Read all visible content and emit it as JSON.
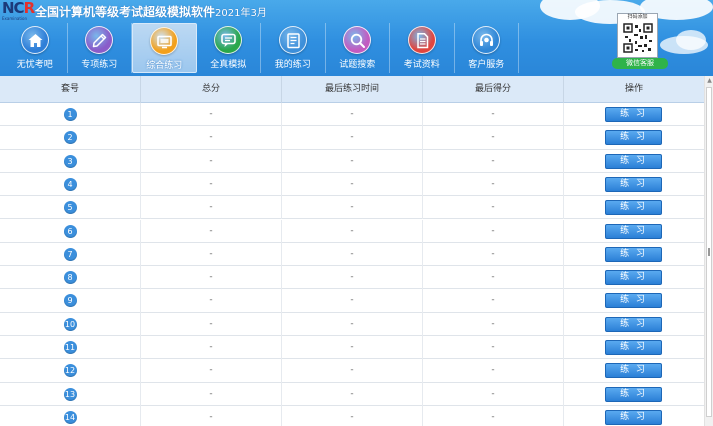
{
  "app": {
    "title": "全国计算机等级考试超级模拟软件",
    "version": "2021年3月",
    "logo_letters_a": "NC",
    "logo_letters_b": "R",
    "logo_sub": "Examination"
  },
  "nav": [
    {
      "label": "无忧考吧",
      "icon": "home-icon",
      "color": "#2f7fd8"
    },
    {
      "label": "专项练习",
      "icon": "pencil-icon",
      "color": "#8a5cc9"
    },
    {
      "label": "综合练习",
      "icon": "monitor-icon",
      "color": "#f2a01c",
      "active": true
    },
    {
      "label": "全真模拟",
      "icon": "chat-icon",
      "color": "#2aa74a"
    },
    {
      "label": "我的练习",
      "icon": "document-icon",
      "color": "#3d8fd9"
    },
    {
      "label": "试题搜索",
      "icon": "search-icon",
      "color": "#c35bc0"
    },
    {
      "label": "考试资料",
      "icon": "file-icon",
      "color": "#e0463f"
    },
    {
      "label": "客户服务",
      "icon": "headset-icon",
      "color": "#2f86d6"
    }
  ],
  "wechat": {
    "label": "微信客服",
    "qr_header": "扫码添加"
  },
  "table": {
    "headers": [
      "套号",
      "总分",
      "最后练习时间",
      "最后得分",
      "操作"
    ],
    "action_label": "练 习",
    "empty": "-",
    "rows": [
      "1",
      "2",
      "3",
      "4",
      "5",
      "6",
      "7",
      "8",
      "9",
      "10",
      "11",
      "12",
      "13",
      "14"
    ]
  },
  "colors": {
    "header": "#2f8fe0",
    "button": "#2b7fd6",
    "badge": "#3b8fdc"
  }
}
